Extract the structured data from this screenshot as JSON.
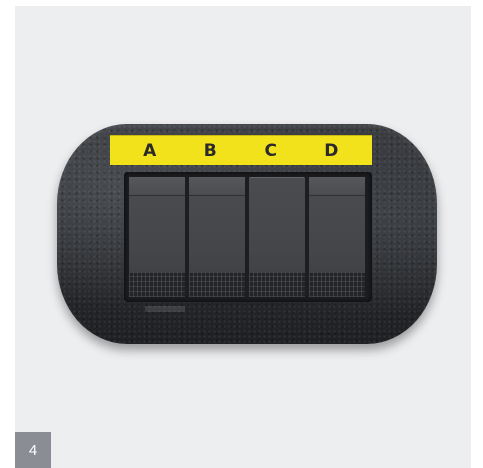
{
  "switch_plate": {
    "labels": [
      "A",
      "B",
      "C",
      "D"
    ],
    "label_color": "#f2e21b",
    "plate_color": "#2b2d30"
  },
  "page_number": "4"
}
